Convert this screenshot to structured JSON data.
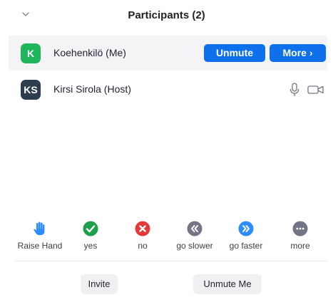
{
  "header": {
    "title": "Participants (2)"
  },
  "participants": [
    {
      "initials": "K",
      "name": "Koehenkilö (Me)",
      "avatar_color": "#1fb55b",
      "actions": {
        "unmute": "Unmute",
        "more": "More ›"
      }
    },
    {
      "initials": "KS",
      "name": "Kirsi Sirola (Host)",
      "avatar_color": "#2d3c4e"
    }
  ],
  "reactions": [
    {
      "label": "Raise Hand",
      "icon": "raise-hand-icon",
      "color": "#2d8cff"
    },
    {
      "label": "yes",
      "icon": "check-icon",
      "color": "#1ea04a"
    },
    {
      "label": "no",
      "icon": "x-icon",
      "color": "#e5393a"
    },
    {
      "label": "go slower",
      "icon": "rewind-icon",
      "color": "#747487"
    },
    {
      "label": "go faster",
      "icon": "fast-forward-icon",
      "color": "#2d8cff"
    },
    {
      "label": "more",
      "icon": "ellipsis-icon",
      "color": "#747487"
    }
  ],
  "footer": {
    "invite": "Invite",
    "unmute_me": "Unmute Me"
  },
  "colors": {
    "primary": "#0e71eb"
  }
}
